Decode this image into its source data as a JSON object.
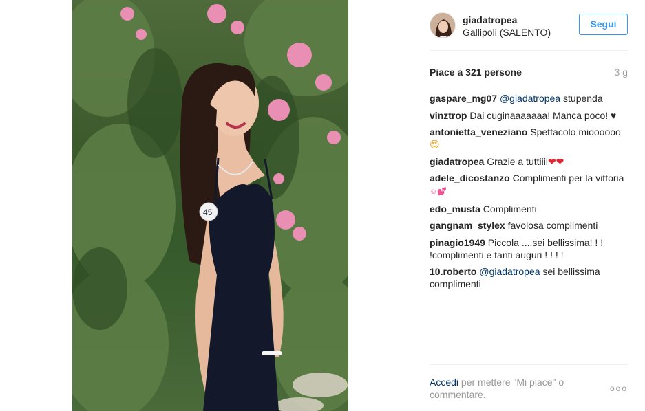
{
  "post": {
    "photo": {
      "tag_number": "45"
    }
  },
  "header": {
    "username": "giadatropea",
    "location": "Gallipoli (SALENTO)",
    "follow_label": "Segui"
  },
  "stats": {
    "likes_text": "Piace a 321 persone",
    "time_ago": "3 g"
  },
  "comments": [
    {
      "user": "gaspare_mg07",
      "mention": "@giadatropea",
      "text": " stupenda"
    },
    {
      "user": "vinztrop",
      "text": " Dai cuginaaaaaaa! Manca poco! ",
      "emoji": "♥"
    },
    {
      "user": "antonietta_veneziano",
      "text": " Spettacolo mioooooo",
      "emoji": "😍"
    },
    {
      "user": "giadatropea",
      "text": " Grazie a tuttiiii",
      "emoji": "❤❤"
    },
    {
      "user": "adele_dicostanzo",
      "text": " Complimenti per la vittoria ",
      "emoji": "☺💕"
    },
    {
      "user": "edo_musta",
      "text": " Complimenti"
    },
    {
      "user": "gangnam_stylex",
      "text": " favolosa complimenti"
    },
    {
      "user": "pinagio1949",
      "text": " Piccola ....sei bellissima! ! ! !complimenti e tanti auguri ! ! ! !"
    },
    {
      "user": "10.roberto",
      "mention": "@giadatropea",
      "text": " sei bellissima complimenti"
    }
  ],
  "footer": {
    "login_link": "Accedi",
    "login_text": " per mettere \"Mi piace\" o commentare.",
    "more_label": "ooo"
  },
  "colors": {
    "accent": "#3897f0",
    "link": "#003569",
    "muted": "#999999"
  },
  "icons": {
    "more": "more-options-icon"
  }
}
